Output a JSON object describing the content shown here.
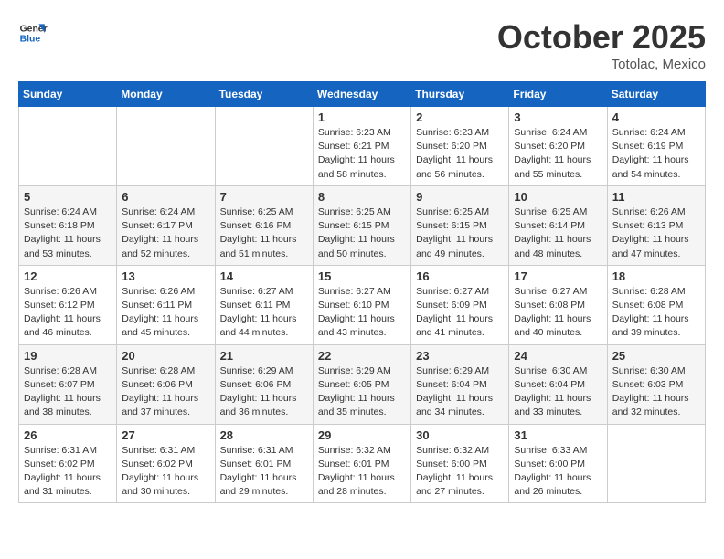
{
  "header": {
    "logo_line1": "General",
    "logo_line2": "Blue",
    "month": "October 2025",
    "location": "Totolac, Mexico"
  },
  "weekdays": [
    "Sunday",
    "Monday",
    "Tuesday",
    "Wednesday",
    "Thursday",
    "Friday",
    "Saturday"
  ],
  "weeks": [
    [
      {
        "day": "",
        "info": ""
      },
      {
        "day": "",
        "info": ""
      },
      {
        "day": "",
        "info": ""
      },
      {
        "day": "1",
        "info": "Sunrise: 6:23 AM\nSunset: 6:21 PM\nDaylight: 11 hours\nand 58 minutes."
      },
      {
        "day": "2",
        "info": "Sunrise: 6:23 AM\nSunset: 6:20 PM\nDaylight: 11 hours\nand 56 minutes."
      },
      {
        "day": "3",
        "info": "Sunrise: 6:24 AM\nSunset: 6:20 PM\nDaylight: 11 hours\nand 55 minutes."
      },
      {
        "day": "4",
        "info": "Sunrise: 6:24 AM\nSunset: 6:19 PM\nDaylight: 11 hours\nand 54 minutes."
      }
    ],
    [
      {
        "day": "5",
        "info": "Sunrise: 6:24 AM\nSunset: 6:18 PM\nDaylight: 11 hours\nand 53 minutes."
      },
      {
        "day": "6",
        "info": "Sunrise: 6:24 AM\nSunset: 6:17 PM\nDaylight: 11 hours\nand 52 minutes."
      },
      {
        "day": "7",
        "info": "Sunrise: 6:25 AM\nSunset: 6:16 PM\nDaylight: 11 hours\nand 51 minutes."
      },
      {
        "day": "8",
        "info": "Sunrise: 6:25 AM\nSunset: 6:15 PM\nDaylight: 11 hours\nand 50 minutes."
      },
      {
        "day": "9",
        "info": "Sunrise: 6:25 AM\nSunset: 6:15 PM\nDaylight: 11 hours\nand 49 minutes."
      },
      {
        "day": "10",
        "info": "Sunrise: 6:25 AM\nSunset: 6:14 PM\nDaylight: 11 hours\nand 48 minutes."
      },
      {
        "day": "11",
        "info": "Sunrise: 6:26 AM\nSunset: 6:13 PM\nDaylight: 11 hours\nand 47 minutes."
      }
    ],
    [
      {
        "day": "12",
        "info": "Sunrise: 6:26 AM\nSunset: 6:12 PM\nDaylight: 11 hours\nand 46 minutes."
      },
      {
        "day": "13",
        "info": "Sunrise: 6:26 AM\nSunset: 6:11 PM\nDaylight: 11 hours\nand 45 minutes."
      },
      {
        "day": "14",
        "info": "Sunrise: 6:27 AM\nSunset: 6:11 PM\nDaylight: 11 hours\nand 44 minutes."
      },
      {
        "day": "15",
        "info": "Sunrise: 6:27 AM\nSunset: 6:10 PM\nDaylight: 11 hours\nand 43 minutes."
      },
      {
        "day": "16",
        "info": "Sunrise: 6:27 AM\nSunset: 6:09 PM\nDaylight: 11 hours\nand 41 minutes."
      },
      {
        "day": "17",
        "info": "Sunrise: 6:27 AM\nSunset: 6:08 PM\nDaylight: 11 hours\nand 40 minutes."
      },
      {
        "day": "18",
        "info": "Sunrise: 6:28 AM\nSunset: 6:08 PM\nDaylight: 11 hours\nand 39 minutes."
      }
    ],
    [
      {
        "day": "19",
        "info": "Sunrise: 6:28 AM\nSunset: 6:07 PM\nDaylight: 11 hours\nand 38 minutes."
      },
      {
        "day": "20",
        "info": "Sunrise: 6:28 AM\nSunset: 6:06 PM\nDaylight: 11 hours\nand 37 minutes."
      },
      {
        "day": "21",
        "info": "Sunrise: 6:29 AM\nSunset: 6:06 PM\nDaylight: 11 hours\nand 36 minutes."
      },
      {
        "day": "22",
        "info": "Sunrise: 6:29 AM\nSunset: 6:05 PM\nDaylight: 11 hours\nand 35 minutes."
      },
      {
        "day": "23",
        "info": "Sunrise: 6:29 AM\nSunset: 6:04 PM\nDaylight: 11 hours\nand 34 minutes."
      },
      {
        "day": "24",
        "info": "Sunrise: 6:30 AM\nSunset: 6:04 PM\nDaylight: 11 hours\nand 33 minutes."
      },
      {
        "day": "25",
        "info": "Sunrise: 6:30 AM\nSunset: 6:03 PM\nDaylight: 11 hours\nand 32 minutes."
      }
    ],
    [
      {
        "day": "26",
        "info": "Sunrise: 6:31 AM\nSunset: 6:02 PM\nDaylight: 11 hours\nand 31 minutes."
      },
      {
        "day": "27",
        "info": "Sunrise: 6:31 AM\nSunset: 6:02 PM\nDaylight: 11 hours\nand 30 minutes."
      },
      {
        "day": "28",
        "info": "Sunrise: 6:31 AM\nSunset: 6:01 PM\nDaylight: 11 hours\nand 29 minutes."
      },
      {
        "day": "29",
        "info": "Sunrise: 6:32 AM\nSunset: 6:01 PM\nDaylight: 11 hours\nand 28 minutes."
      },
      {
        "day": "30",
        "info": "Sunrise: 6:32 AM\nSunset: 6:00 PM\nDaylight: 11 hours\nand 27 minutes."
      },
      {
        "day": "31",
        "info": "Sunrise: 6:33 AM\nSunset: 6:00 PM\nDaylight: 11 hours\nand 26 minutes."
      },
      {
        "day": "",
        "info": ""
      }
    ]
  ]
}
